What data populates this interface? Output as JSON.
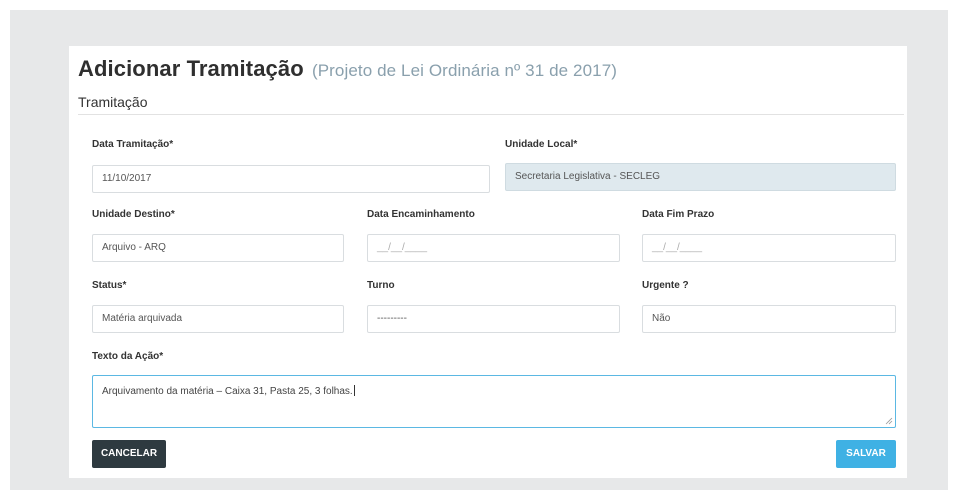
{
  "page": {
    "title": "Adicionar Tramitação",
    "subtitle": "(Projeto de Lei Ordinária nº 31 de 2017)",
    "section": "Tramitação"
  },
  "form": {
    "data_tramitacao": {
      "label": "Data Tramitação*",
      "value": "11/10/2017"
    },
    "unidade_local": {
      "label": "Unidade Local*",
      "value": "Secretaria Legislativa - SECLEG"
    },
    "unidade_destino": {
      "label": "Unidade Destino*",
      "value": "Arquivo - ARQ"
    },
    "data_encaminhamento": {
      "label": "Data Encaminhamento",
      "placeholder": "__/__/____"
    },
    "data_fim_prazo": {
      "label": "Data Fim Prazo",
      "placeholder": "__/__/____"
    },
    "status": {
      "label": "Status*",
      "value": "Matéria arquivada"
    },
    "turno": {
      "label": "Turno",
      "value": "---------"
    },
    "urgente": {
      "label": "Urgente ?",
      "value": "Não"
    },
    "texto_acao": {
      "label": "Texto da Ação*",
      "value": "Arquivamento da matéria – Caixa 31, Pasta 25, 3 folhas."
    }
  },
  "buttons": {
    "cancel": "CANCELAR",
    "save": "SALVAR"
  },
  "colors": {
    "save": "#3fb1e4",
    "cancel": "#2e3a40",
    "readonly_field": "#dfe9ee",
    "subtitle": "#8aa0ad"
  }
}
